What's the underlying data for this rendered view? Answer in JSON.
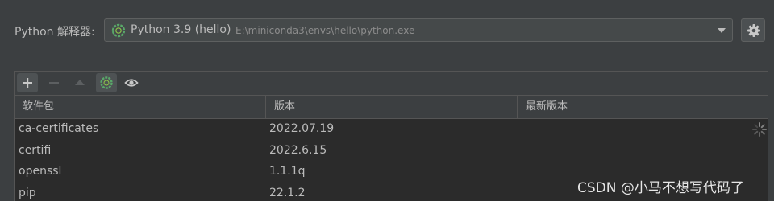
{
  "interpreter": {
    "label": "Python 解释器:",
    "name": "Python 3.9 (hello)",
    "path": "E:\\miniconda3\\envs\\hello\\python.exe",
    "icon": "conda-spinner-icon",
    "dropdown_icon": "chevron-down-icon",
    "settings_icon": "gear-icon"
  },
  "toolbar": {
    "add_icon": "plus-icon",
    "remove_icon": "minus-icon",
    "upgrade_icon": "arrow-up-icon",
    "conda_icon": "conda-icon",
    "show_icon": "eye-icon"
  },
  "table": {
    "columns": [
      "软件包",
      "版本",
      "最新版本"
    ],
    "rows": [
      {
        "package": "ca-certificates",
        "version": "2022.07.19",
        "latest": ""
      },
      {
        "package": "certifi",
        "version": "2022.6.15",
        "latest": ""
      },
      {
        "package": "openssl",
        "version": "1.1.1q",
        "latest": ""
      },
      {
        "package": "pip",
        "version": "22.1.2",
        "latest": ""
      }
    ],
    "loading_icon": "loading-spinner-icon"
  },
  "watermark": "CSDN @小马不想写代码了",
  "colors": {
    "background": "#3c3f41",
    "table_background": "#2b2b2b",
    "text": "#bbbbbb",
    "accent_green": "#59a869"
  }
}
